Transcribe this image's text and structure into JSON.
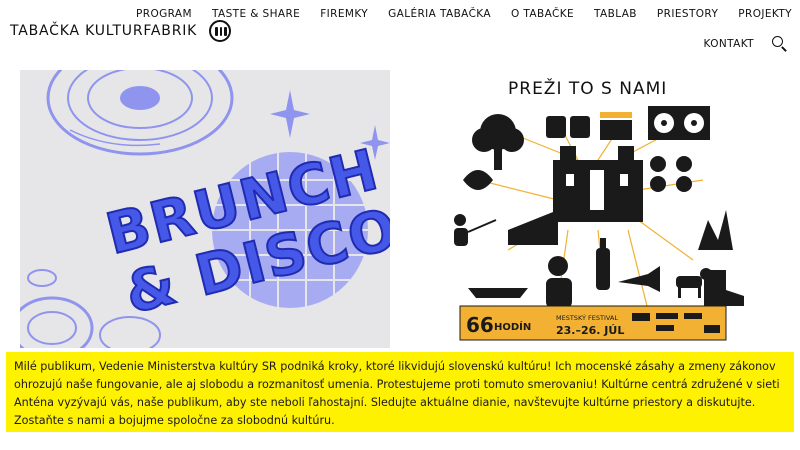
{
  "brand": {
    "name": "TABAČKA KULTURFABRIK",
    "logo_icon": "brand-logo-icon"
  },
  "nav": {
    "row1": [
      "PROGRAM",
      "TASTE & SHARE",
      "FIREMKY",
      "GALÉRIA TABAČKA",
      "O TABAČKE",
      "TABLAB",
      "PRIESTORY",
      "PROJEKTY"
    ],
    "row2": [
      "KONTAKT"
    ],
    "search_icon": "search-icon"
  },
  "cards": {
    "left": {
      "headline_1": "BRUNCH",
      "headline_2": "& DISCO",
      "accent": "#3a4fe0",
      "tint": "#8f94ee"
    },
    "right": {
      "title": "PREŽI TO S NAMI",
      "hours_number": "66",
      "hours_label": "HODÍN",
      "festival_label": "MESTSKÝ FESTIVAL",
      "dates": "23.–26. JÚL",
      "accent": "#f2b133"
    }
  },
  "notice": {
    "text": "Milé publikum, Vedenie Ministerstva kultúry SR podniká kroky, ktoré likvidujú slovenskú kultúru! Ich mocenské zásahy a zmeny zákonov ohrozujú naše fungovanie, ale aj slobodu a rozmanitosť umenia. Protestujeme proti tomuto smerovaniu! Kultúrne centrá združené v sieti Anténa vyzývajú vás, naše publikum, aby ste neboli ľahostajní. Sledujte aktuálne dianie, navštevujte kultúrne priestory a diskutujte. Zostaňte s nami a bojujme spoločne za slobodnú kultúru.",
    "background": "#fff200"
  }
}
